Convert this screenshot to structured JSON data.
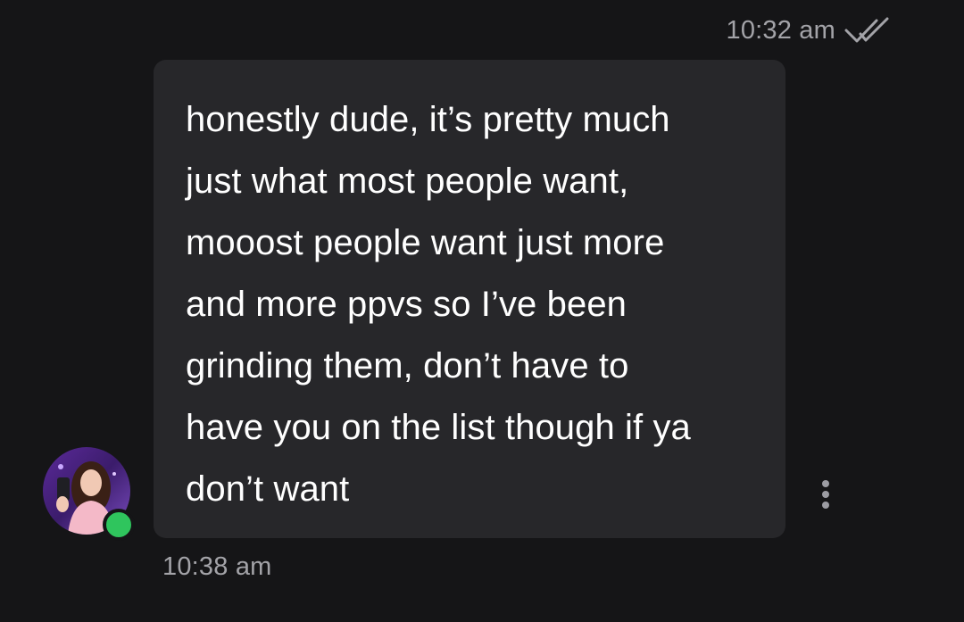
{
  "conversation": {
    "previous_message": {
      "time": "10:32 am",
      "status_icon": "double-check-icon"
    },
    "message": {
      "text": "honestly dude, it’s pretty much\njust what most people want,\nmooost people want just more\nand more ppvs so I’ve been\ngrinding them, don’t have to\nhave you on the list though if ya\ndon’t want",
      "time": "10:38 am",
      "sender_status": "online",
      "menu_icon": "vertical-ellipsis-icon"
    }
  },
  "colors": {
    "background": "#151517",
    "bubble": "#27272a",
    "text": "#ffffff",
    "meta_text": "#a3a3a8",
    "online": "#2fc55d"
  }
}
